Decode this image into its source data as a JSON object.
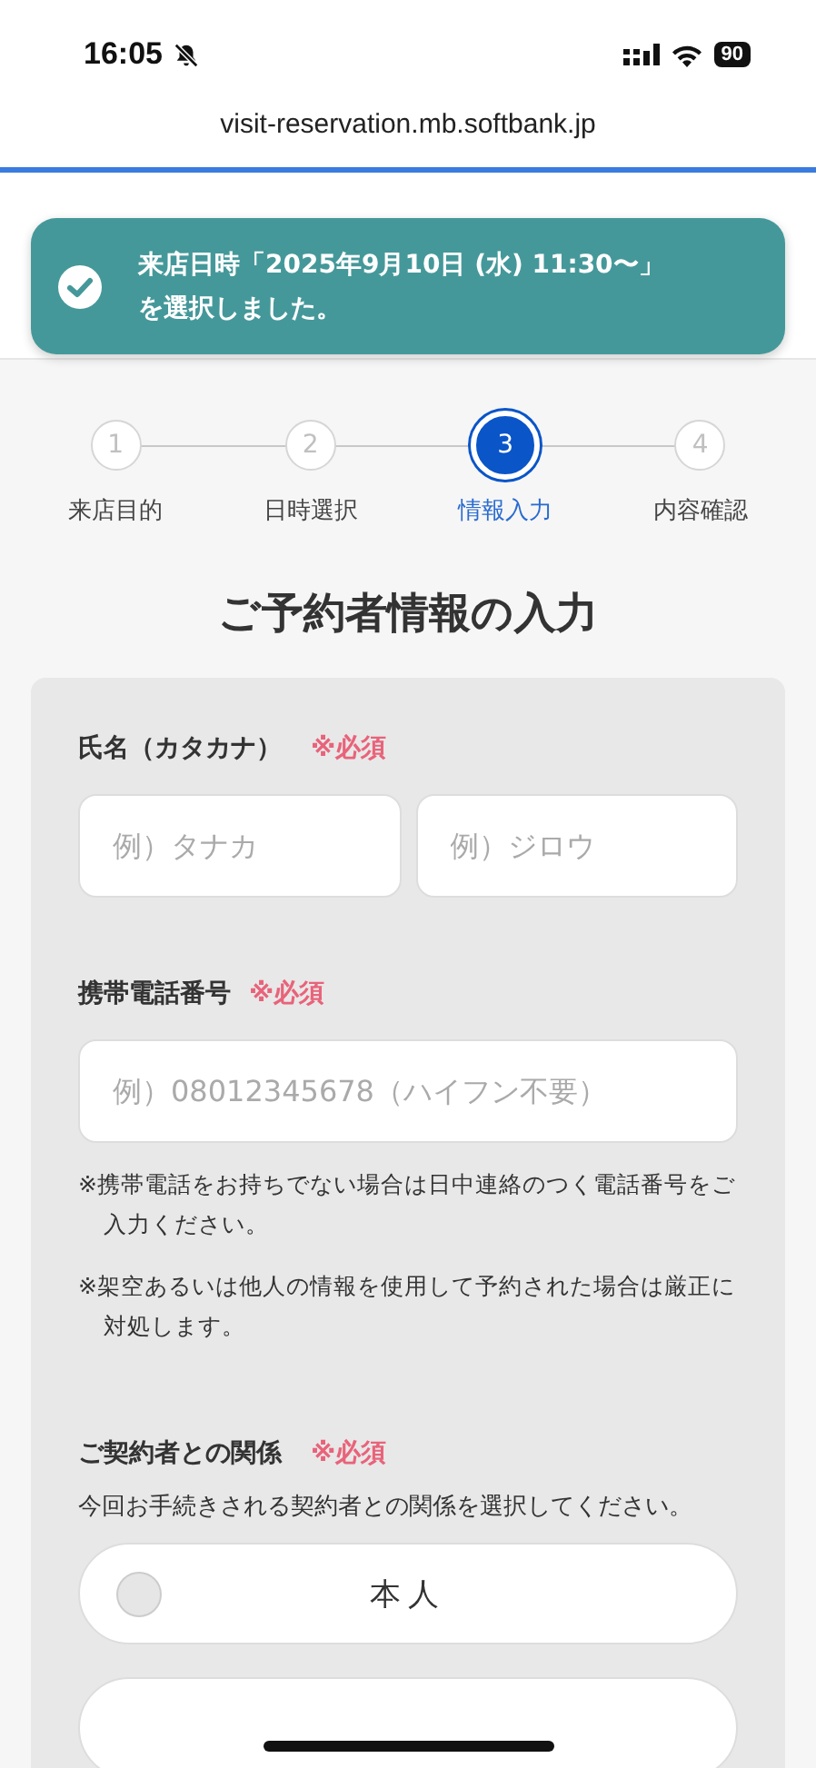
{
  "status_bar": {
    "time": "16:05",
    "silent": true,
    "battery": "90"
  },
  "browser": {
    "url": "visit-reservation.mb.softbank.jp"
  },
  "toast": {
    "line1": "来店日時「2025年9月10日 (水) 11:30〜」",
    "line2": "を選択しました。"
  },
  "steps": [
    {
      "number": "1",
      "label": "来店目的",
      "selected": false
    },
    {
      "number": "2",
      "label": "日時選択",
      "selected": false
    },
    {
      "number": "3",
      "label": "情報入力",
      "selected": true
    },
    {
      "number": "4",
      "label": "内容確認",
      "selected": false
    }
  ],
  "title": "ご予約者情報の入力",
  "form": {
    "name": {
      "label": "氏名（カタカナ）",
      "required": "※必須",
      "fields": [
        {
          "placeholder": "例）タナカ"
        },
        {
          "placeholder": "例）ジロウ"
        }
      ]
    },
    "phone": {
      "label": "携帯電話番号",
      "required": "※必須",
      "placeholder": "例）08012345678（ハイフン不要）",
      "notes": [
        "※携帯電話をお持ちでない場合は日中連絡のつく電話番号をご入力ください。",
        "※架空あるいは他人の情報を使用して予約された場合は厳正に対処します。"
      ]
    },
    "relation": {
      "label": "ご契約者との関係",
      "required": "※必須",
      "description": "今回お手続きされる契約者との関係を選択してください。",
      "options": [
        {
          "label": "本人",
          "selected": false
        }
      ]
    }
  }
}
